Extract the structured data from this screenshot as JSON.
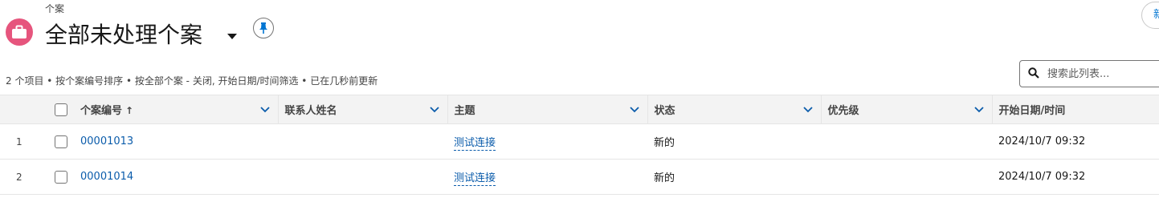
{
  "header": {
    "object_label": "个案",
    "list_title": "全部未处理个案",
    "new_button_label": "新",
    "icon": "briefcase-icon",
    "icon_color": "#e6557d"
  },
  "list_info": "2 个项目 • 按个案编号排序 • 按全部个案 - 关闭, 开始日期/时间筛选 • 已在几秒前更新",
  "search": {
    "placeholder": "搜索此列表..."
  },
  "table": {
    "columns": [
      {
        "label": "个案编号",
        "sorted": "ascending",
        "sort_icon": "↑"
      },
      {
        "label": "联系人姓名"
      },
      {
        "label": "主题"
      },
      {
        "label": "状态"
      },
      {
        "label": "优先级"
      },
      {
        "label": "开始日期/时间"
      }
    ],
    "rows": [
      {
        "num": "1",
        "case_number": "00001013",
        "contact": "",
        "subject": "测试连接",
        "status": "新的",
        "priority": "",
        "start": "2024/10/7 09:32"
      },
      {
        "num": "2",
        "case_number": "00001014",
        "contact": "",
        "subject": "测试连接",
        "status": "新的",
        "priority": "",
        "start": "2024/10/7 09:32"
      }
    ]
  },
  "colors": {
    "link": "#0b5cab",
    "header_bg": "#f3f3f3"
  }
}
